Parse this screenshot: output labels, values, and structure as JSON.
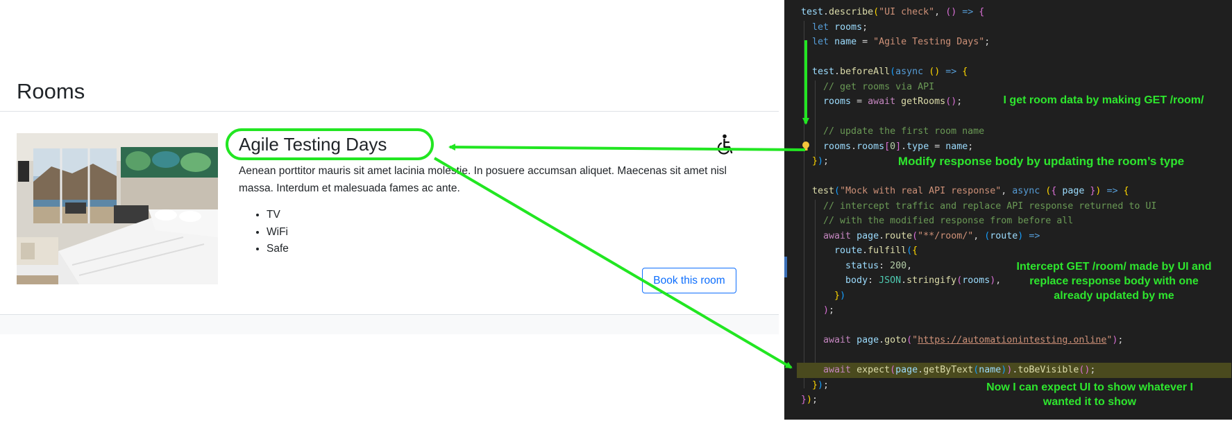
{
  "webpage": {
    "heading": "Rooms",
    "room": {
      "name": "Agile Testing Days",
      "description": "Aenean porttitor mauris sit amet lacinia molestie. In posuere accumsan aliquet. Maecenas sit amet nisl massa. Interdum et malesuada fames ac ante.",
      "features": [
        "TV",
        "WiFi",
        "Safe"
      ],
      "accessibility_icon": "wheelchair-icon",
      "book_button": "Book this room"
    }
  },
  "editor": {
    "lines": [
      "<span class=\"t-var\">test</span>.<span class=\"t-fn\">describe</span><span class=\"t-p1\">(</span><span class=\"t-str\">\"UI check\"</span>, <span class=\"t-p2\">()</span> <span class=\"t-kw\">=></span> <span class=\"t-p2\">{</span>",
      "  <span class=\"t-kw\">let</span> <span class=\"t-var\">rooms</span>;",
      "  <span class=\"t-kw\">let</span> <span class=\"t-var\">name</span> = <span class=\"t-str\">\"Agile Testing Days\"</span>;",
      "",
      "  <span class=\"t-var\">test</span>.<span class=\"t-fn\">beforeAll</span><span class=\"t-p3\">(</span><span class=\"t-kw\">async</span> <span class=\"t-p1\">()</span> <span class=\"t-kw\">=></span> <span class=\"t-p1\">{</span>",
      "    <span class=\"t-cmt\">// get rooms via API</span>",
      "    <span class=\"t-var\">rooms</span> = <span class=\"t-ctl\">await</span> <span class=\"t-fn\">getRooms</span><span class=\"t-p2\">()</span>;",
      "",
      "    <span class=\"t-cmt\">// update the first room name</span>",
      "    <span class=\"t-var\">rooms</span>.<span class=\"t-var\">rooms</span><span class=\"t-p2\">[</span><span class=\"t-num\">0</span><span class=\"t-p2\">]</span>.<span class=\"t-var\">type</span> = <span class=\"t-var\">name</span>;",
      "  <span class=\"t-p1\">}</span><span class=\"t-p3\">)</span>;",
      "",
      "  <span class=\"t-fn\">test</span><span class=\"t-p3\">(</span><span class=\"t-str\">\"Mock with real API response\"</span>, <span class=\"t-kw\">async</span> <span class=\"t-p1\">(</span><span class=\"t-p2\">{</span> <span class=\"t-var\">page</span> <span class=\"t-p2\">}</span><span class=\"t-p1\">)</span> <span class=\"t-kw\">=></span> <span class=\"t-p1\">{</span>",
      "    <span class=\"t-cmt\">// intercept traffic and replace API response returned to UI</span>",
      "    <span class=\"t-cmt\">// with the modified response from before all</span>",
      "    <span class=\"t-ctl\">await</span> <span class=\"t-var\">page</span>.<span class=\"t-fn\">route</span><span class=\"t-p2\">(</span><span class=\"t-str\">\"**/room/\"</span>, <span class=\"t-p3\">(</span><span class=\"t-var\">route</span><span class=\"t-p3\">)</span> <span class=\"t-kw\">=></span>",
      "      <span class=\"t-var\">route</span>.<span class=\"t-fn\">fulfill</span><span class=\"t-p3\">(</span><span class=\"t-p1\">{</span>",
      "        <span class=\"t-var\">status</span>: <span class=\"t-num\">200</span>,",
      "        <span class=\"t-var\">body</span>: <span class=\"t-obj\">JSON</span>.<span class=\"t-fn\">stringify</span><span class=\"t-p2\">(</span><span class=\"t-var\">rooms</span><span class=\"t-p2\">)</span>,",
      "      <span class=\"t-p1\">}</span><span class=\"t-p3\">)</span>",
      "    <span class=\"t-p2\">)</span>;",
      "",
      "    <span class=\"t-ctl\">await</span> <span class=\"t-var\">page</span>.<span class=\"t-fn\">goto</span><span class=\"t-p2\">(</span><span class=\"t-str\">\"</span><span class=\"t-url\">https://automationintesting.online</span><span class=\"t-str\">\"</span><span class=\"t-p2\">)</span>;",
      "",
      "    <span class=\"t-ctl\">await</span> <span class=\"t-fn\">expect</span><span class=\"t-p2\">(</span><span class=\"t-var\">page</span>.<span class=\"t-fn\">getByText</span><span class=\"t-p3\">(</span><span class=\"t-var\">name</span><span class=\"t-p3\">)</span><span class=\"t-p2\">)</span>.<span class=\"t-fn\">toBeVisible</span><span class=\"t-p2\">()</span>;",
      "  <span class=\"t-p1\">}</span><span class=\"t-p3\">)</span>;",
      "<span class=\"t-p2\">}</span><span class=\"t-p1\">)</span>;"
    ],
    "highlight_line_index": 24
  },
  "annotations": {
    "get_rooms": "I get room data by making GET /room/",
    "modify_body": "Modify response body by updating the room’s type",
    "intercept": "Intercept GET /room/ made by UI and replace response body with one already updated by me",
    "intercept_lines": [
      "Intercept GET /room/ made by UI and",
      "replace response body with one",
      "already updated by me"
    ],
    "expect": "Now I can expect UI to show whatever I wanted it to show",
    "expect_lines": [
      "Now I can expect UI to show whatever I",
      "wanted it to show"
    ],
    "arrow_color": "#22e622"
  },
  "colors": {
    "link_blue": "#0d6efd",
    "editor_bg": "#1f1f1f",
    "annotation_green": "#2ee62e"
  }
}
